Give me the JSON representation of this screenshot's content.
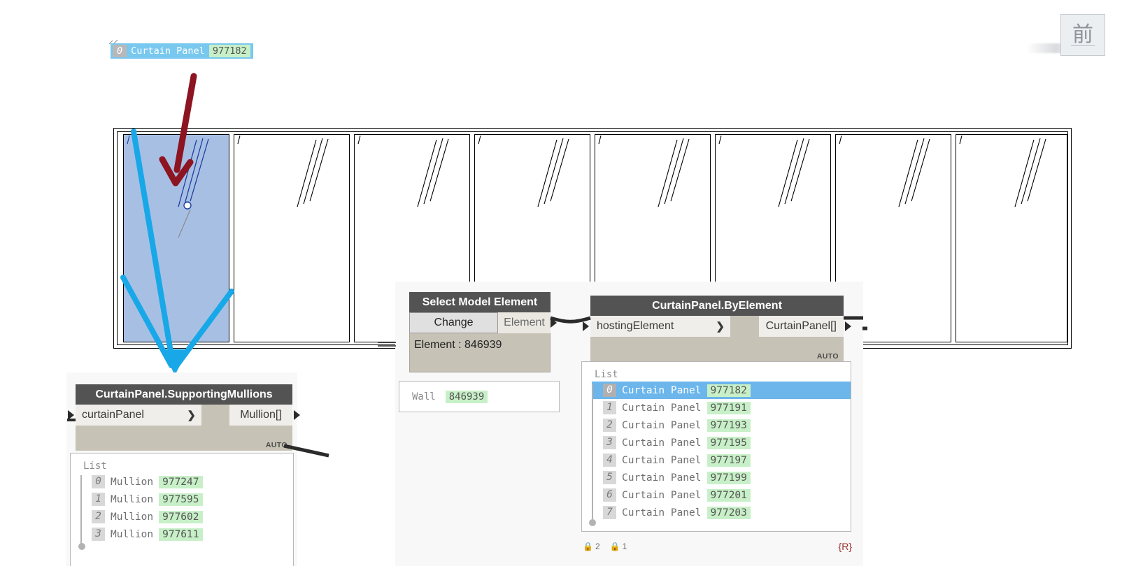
{
  "app": {
    "name": "Revit with Dynamo player overlay"
  },
  "revit": {
    "tooltip": {
      "index": "0",
      "name": "Curtain Panel",
      "id": "977182"
    },
    "viewcube": {
      "face_label": "前"
    },
    "curtain_wall": {
      "panel_count": 8,
      "selected_panel_index": 0
    }
  },
  "annotations": {
    "red_arrow": {
      "name": "red-arrow-pointing-to-selected-panel",
      "color": "#8d1421"
    },
    "cyan_arrows": {
      "name": "cyan-arrows-linking-panel-to-mullions-node",
      "color": "#18a8e8"
    }
  },
  "dynamo": {
    "nodes": [
      {
        "id": "select-model-element",
        "title": "Select Model Element",
        "change_label": "Change",
        "output_label": "Element",
        "info_text": "Element : 846939"
      },
      {
        "id": "curtainpanel-byelement",
        "title": "CurtainPanel.ByElement",
        "input_label": "hostingElement",
        "output_label": "CurtainPanel[]",
        "chevron": "❯",
        "auto_label": "AUTO"
      },
      {
        "id": "curtainpanel-supportingmullions",
        "title": "CurtainPanel.SupportingMullions",
        "input_label": "curtainPanel",
        "output_label": "Mullion[]",
        "chevron": "❯",
        "auto_label": "AUTO"
      }
    ],
    "watch_wall": {
      "label": "Wall",
      "value": "846939"
    },
    "panel_list": {
      "title": "List",
      "rows": [
        {
          "index": "0",
          "name": "Curtain Panel",
          "value": "977182",
          "selected": true
        },
        {
          "index": "1",
          "name": "Curtain Panel",
          "value": "977191",
          "selected": false
        },
        {
          "index": "2",
          "name": "Curtain Panel",
          "value": "977193",
          "selected": false
        },
        {
          "index": "3",
          "name": "Curtain Panel",
          "value": "977195",
          "selected": false
        },
        {
          "index": "4",
          "name": "Curtain Panel",
          "value": "977197",
          "selected": false
        },
        {
          "index": "5",
          "name": "Curtain Panel",
          "value": "977199",
          "selected": false
        },
        {
          "index": "6",
          "name": "Curtain Panel",
          "value": "977201",
          "selected": false
        },
        {
          "index": "7",
          "name": "Curtain Panel",
          "value": "977203",
          "selected": false
        }
      ]
    },
    "mullion_list": {
      "title": "List",
      "rows": [
        {
          "index": "0",
          "name": "Mullion",
          "value": "977247",
          "selected": false
        },
        {
          "index": "1",
          "name": "Mullion",
          "value": "977595",
          "selected": false
        },
        {
          "index": "2",
          "name": "Mullion",
          "value": "977602",
          "selected": false
        },
        {
          "index": "3",
          "name": "Mullion",
          "value": "977611",
          "selected": false
        }
      ]
    },
    "status_bar": {
      "items": [
        {
          "icon": "lock-icon",
          "value": "2"
        },
        {
          "icon": "lock-icon",
          "value": "1"
        }
      ],
      "right_glyph": "{R}"
    }
  },
  "colors": {
    "node_title_bg": "#535353",
    "node_body_bg": "#c6c2b6",
    "port_bg": "#f0eeea",
    "selection_blue": "#a8bfe4",
    "list_highlight": "#6cb6ec",
    "value_green": "#c8f0c8",
    "tooltip_blue": "#78c8ef",
    "canvas_bg": "#f8f8f8",
    "wire": "#2b2b2b"
  }
}
